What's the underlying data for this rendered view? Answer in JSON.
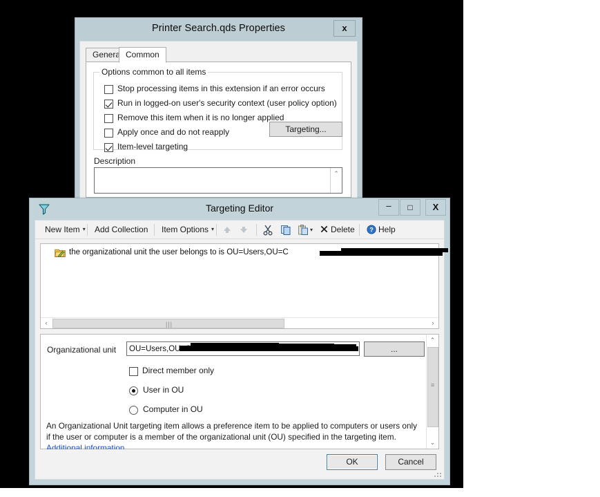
{
  "properties_dialog": {
    "title": "Printer Search.qds Properties",
    "close_label": "x",
    "tabs": [
      {
        "label": "General",
        "active": false
      },
      {
        "label": "Common",
        "active": true
      }
    ],
    "group_legend": "Options common to all items",
    "checkboxes": [
      {
        "label": "Stop processing items in this extension if an error occurs",
        "checked": false
      },
      {
        "label": "Run in logged-on user's security context (user policy option)",
        "checked": true
      },
      {
        "label": "Remove this item when it is no longer applied",
        "checked": false
      },
      {
        "label": "Apply once and do not reapply",
        "checked": false
      },
      {
        "label": "Item-level targeting",
        "checked": true
      }
    ],
    "targeting_button": "Targeting...",
    "description_label": "Description",
    "description_value": ""
  },
  "targeting_editor": {
    "title": "Targeting Editor",
    "titlebar_icon": "filter-icon",
    "window_buttons": {
      "minimize": "–",
      "maximize": "□",
      "close": "X"
    },
    "toolbar": {
      "new_item": "New Item",
      "add_collection": "Add Collection",
      "item_options": "Item Options",
      "caret": "▾",
      "move_up": "move-up-icon",
      "move_down": "move-down-icon",
      "cut": "cut-icon",
      "copy": "copy-icon",
      "paste": "paste-icon",
      "delete": "Delete",
      "help": "Help"
    },
    "tree": {
      "item_icon": "ou-targeting-item-icon",
      "item_text": "the organizational unit the user belongs to is OU=Users,OU=C",
      "item_text_redacted": true,
      "hscroll": {
        "left_arrow": "‹",
        "right_arrow": "›",
        "grip": "|||"
      }
    },
    "panel": {
      "ou_label": "Organizational unit",
      "ou_value": "OU=Users,OU=C",
      "ou_value_redacted": true,
      "browse_button": "...",
      "direct_member_only": {
        "label": "Direct member only",
        "checked": false
      },
      "radios": [
        {
          "label": "User in OU",
          "selected": true
        },
        {
          "label": "Computer in OU",
          "selected": false
        }
      ],
      "help_text": "An Organizational Unit targeting item allows a preference item to be applied to computers or users only if the user or computer is a member of the organizational unit (OU) specified in the targeting item. ",
      "help_link": "Additional information",
      "vscroll": {
        "up_arrow": "⌃",
        "down_arrow": "⌄",
        "grip": "≡"
      }
    },
    "footer": {
      "ok": "OK",
      "cancel": "Cancel"
    }
  },
  "colors": {
    "titlebar": "#c2d3da",
    "window_chrome": "#bdcdd4",
    "client": "#f2f2f2",
    "link": "#1a4fd1",
    "focus_border": "#3c7fb1",
    "redaction": "#000000"
  }
}
